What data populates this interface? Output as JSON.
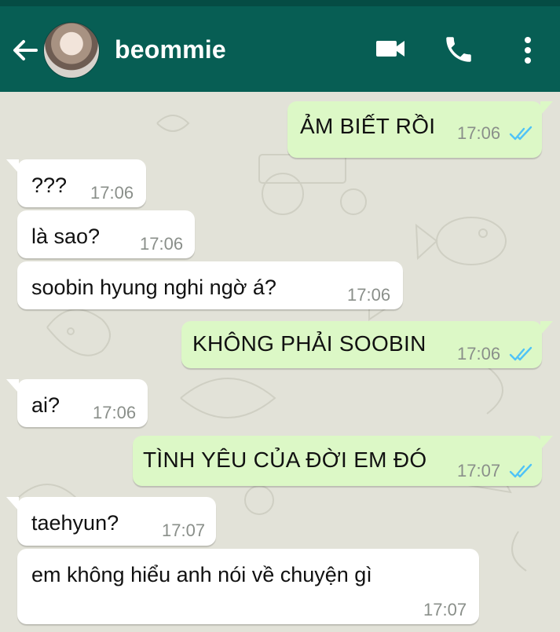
{
  "header": {
    "contact_name": "beommie",
    "icons": [
      "back-arrow-icon",
      "video-call-icon",
      "voice-call-icon",
      "more-options-icon"
    ]
  },
  "colors": {
    "header": "#075e54",
    "outgoing_bubble": "#dcf8c6",
    "incoming_bubble": "#ffffff",
    "read_ticks": "#4fc3f7",
    "chat_background": "#e2e2d8"
  },
  "messages": [
    {
      "direction": "outgoing",
      "text": "ẢM BIẾT RỒI",
      "time": "17:06",
      "status": "read"
    },
    {
      "direction": "incoming",
      "text": "???",
      "time": "17:06"
    },
    {
      "direction": "incoming",
      "text": "là sao?",
      "time": "17:06"
    },
    {
      "direction": "incoming",
      "text": "soobin hyung nghi ngờ á?",
      "time": "17:06"
    },
    {
      "direction": "outgoing",
      "text": "KHÔNG PHẢI SOOBIN",
      "time": "17:06",
      "status": "read"
    },
    {
      "direction": "incoming",
      "text": "ai?",
      "time": "17:06"
    },
    {
      "direction": "outgoing",
      "text": "TÌNH YÊU CỦA ĐỜI EM ĐÓ",
      "time": "17:07",
      "status": "read"
    },
    {
      "direction": "incoming",
      "text": "taehyun?",
      "time": "17:07"
    },
    {
      "direction": "incoming",
      "text": "em không hiểu anh nói về chuyện gì",
      "time": "17:07"
    }
  ]
}
